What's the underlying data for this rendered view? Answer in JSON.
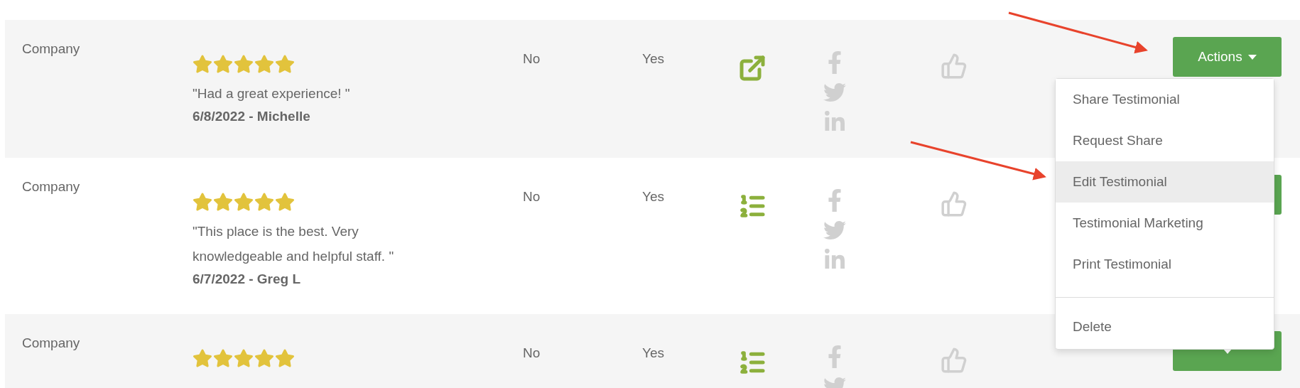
{
  "rows": [
    {
      "source": "Company",
      "stars": 5,
      "review": "\"Had a great experience! \"",
      "byline": "6/8/2022 - Michelle",
      "column_3": "No",
      "column_4": "Yes",
      "type_icon": {
        "kind": "share"
      },
      "actions": "Actions"
    },
    {
      "source": "Company",
      "stars": 5,
      "review": "\"This place is the best. Very knowledgeable and helpful staff. \"",
      "byline": "6/7/2022 - Greg L",
      "column_3": "No",
      "column_4": "Yes",
      "type_icon": {
        "kind": "list"
      }
    },
    {
      "source": "Company",
      "stars": 5,
      "column_3": "No",
      "column_4": "Yes",
      "type_icon": {
        "kind": "list"
      }
    }
  ],
  "dropdown": {
    "items": [
      {
        "kind": "item",
        "label": "Share Testimonial",
        "selected": false
      },
      {
        "kind": "item",
        "label": "Request Share",
        "selected": false
      },
      {
        "kind": "item",
        "label": "Edit Testimonial",
        "selected": true
      },
      {
        "kind": "item",
        "label": "Testimonial Marketing",
        "selected": false
      },
      {
        "kind": "item",
        "label": "Print Testimonial",
        "selected": false
      },
      {
        "kind": "divider"
      },
      {
        "kind": "item",
        "label": "Delete",
        "selected": false
      }
    ]
  }
}
